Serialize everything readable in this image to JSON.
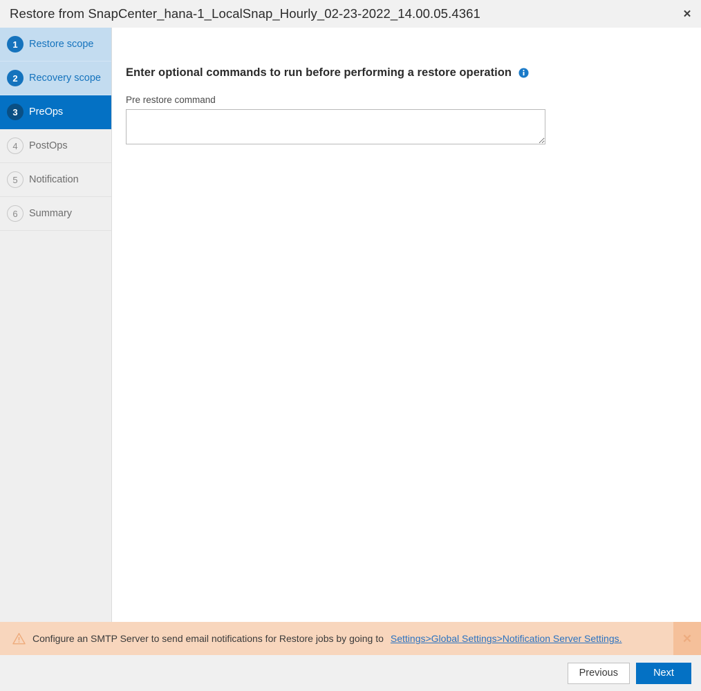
{
  "window": {
    "title": "Restore from SnapCenter_hana-1_LocalSnap_Hourly_02-23-2022_14.00.05.4361",
    "close_label": "✕",
    "close_icon": "close-icon"
  },
  "sidebar": {
    "steps": [
      {
        "number": "1",
        "label": "Restore scope",
        "state": "done"
      },
      {
        "number": "2",
        "label": "Recovery scope",
        "state": "done"
      },
      {
        "number": "3",
        "label": "PreOps",
        "state": "active"
      },
      {
        "number": "4",
        "label": "PostOps",
        "state": "pending"
      },
      {
        "number": "5",
        "label": "Notification",
        "state": "pending"
      },
      {
        "number": "6",
        "label": "Summary",
        "state": "pending"
      }
    ]
  },
  "content": {
    "heading": "Enter optional commands to run before performing a restore operation",
    "info_icon": "info-icon",
    "field_label": "Pre restore command",
    "field_value": "",
    "field_placeholder": ""
  },
  "banner": {
    "warning_icon": "warning-triangle-icon",
    "message": "Configure an SMTP Server to send email notifications for Restore jobs by going to",
    "link_text": "Settings>Global Settings>Notification Server Settings.",
    "close_label": "✕",
    "close_icon": "close-icon"
  },
  "footer": {
    "previous_label": "Previous",
    "next_label": "Next"
  },
  "colors": {
    "accent_blue": "#0471c4",
    "active_badge": "#0a4f84",
    "done_step_bg": "#c3dcf0",
    "done_step_text": "#1573bd",
    "banner_bg": "#f8d6bd",
    "banner_close_bg": "#f5c09a",
    "link_blue": "#2a72c0",
    "sidebar_bg": "#efefef",
    "titlebar_bg": "#f1f1f1",
    "footer_bg": "#f0f0f0"
  }
}
